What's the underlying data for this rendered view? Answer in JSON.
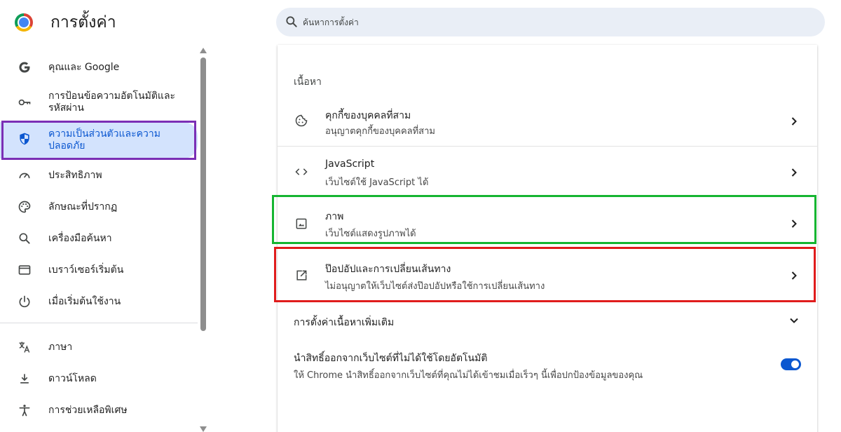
{
  "header": {
    "title": "การตั้งค่า",
    "search_placeholder": "ค้นหาการตั้งค่า"
  },
  "sidebar": {
    "items": [
      {
        "label": "คุณและ Google",
        "icon": "google-g-icon"
      },
      {
        "label": "การป้อนข้อความอัตโนมัติและรหัสผ่าน",
        "icon": "key-icon"
      },
      {
        "label": "ความเป็นส่วนตัวและความปลอดภัย",
        "icon": "shield-icon",
        "active": true
      },
      {
        "label": "ประสิทธิภาพ",
        "icon": "speedometer-icon"
      },
      {
        "label": "ลักษณะที่ปรากฏ",
        "icon": "palette-icon"
      },
      {
        "label": "เครื่องมือค้นหา",
        "icon": "search-icon"
      },
      {
        "label": "เบราว์เซอร์เริ่มต้น",
        "icon": "browser-icon"
      },
      {
        "label": "เมื่อเริ่มต้นใช้งาน",
        "icon": "power-icon"
      },
      {
        "label": "ภาษา",
        "icon": "translate-icon"
      },
      {
        "label": "ดาวน์โหลด",
        "icon": "download-icon"
      },
      {
        "label": "การช่วยเหลือพิเศษ",
        "icon": "accessibility-icon"
      }
    ]
  },
  "content": {
    "section_title": "เนื้อหา",
    "rows": [
      {
        "title": "คุกกี้ของบุคคลที่สาม",
        "subtitle": "อนุญาตคุกกี้ของบุคคลที่สาม",
        "icon": "cookie-icon"
      },
      {
        "title": "JavaScript",
        "subtitle": "เว็บไซต์ใช้ JavaScript ได้",
        "icon": "code-icon"
      },
      {
        "title": "ภาพ",
        "subtitle": "เว็บไซต์แสดงรูปภาพได้",
        "icon": "image-icon"
      },
      {
        "title": "ป๊อปอัปและการเปลี่ยนเส้นทาง",
        "subtitle": "ไม่อนุญาตให้เว็บไซต์ส่งป๊อปอัปหรือใช้การเปลี่ยนเส้นทาง",
        "icon": "open-in-new-icon"
      }
    ],
    "more_settings": "การตั้งค่าเนื้อหาเพิ่มเติม",
    "auto_revoke": {
      "title": "นำสิทธิ์ออกจากเว็บไซต์ที่ไม่ได้ใช้โดยอัตโนมัติ",
      "subtitle": "ให้ Chrome นำสิทธิ์ออกจากเว็บไซต์ที่คุณไม่ได้เข้าชมเมื่อเร็วๆ นี้เพื่อปกป้องข้อมูลของคุณ",
      "enabled": true
    }
  },
  "colors": {
    "accent": "#0b57d0",
    "active_bg": "#d3e3fd",
    "highlight_purple": "#7b2fb5",
    "highlight_green": "#15b531",
    "highlight_red": "#e01c1c"
  }
}
